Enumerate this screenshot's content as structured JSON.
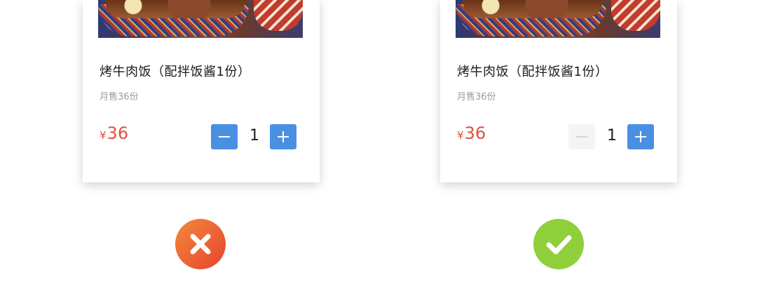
{
  "cards": [
    {
      "variant": "wrong",
      "dish_name": "烤牛肉饭（配拌饭酱1份）",
      "sales": "月售36份",
      "currency": "¥",
      "price": "36",
      "quantity": "1",
      "minus_state": "active",
      "plus_state": "active"
    },
    {
      "variant": "right",
      "dish_name": "烤牛肉饭（配拌饭酱1份）",
      "sales": "月售36份",
      "currency": "¥",
      "price": "36",
      "quantity": "1",
      "minus_state": "disabled",
      "plus_state": "active"
    }
  ],
  "verdicts": [
    {
      "icon": "cross-icon",
      "color": "#ea5a33"
    },
    {
      "icon": "check-icon",
      "color": "#8fcf3c"
    }
  ],
  "colors": {
    "accent_blue": "#4a90e2",
    "price_red": "#e2503e",
    "disabled_bg": "#f4f4f4"
  }
}
